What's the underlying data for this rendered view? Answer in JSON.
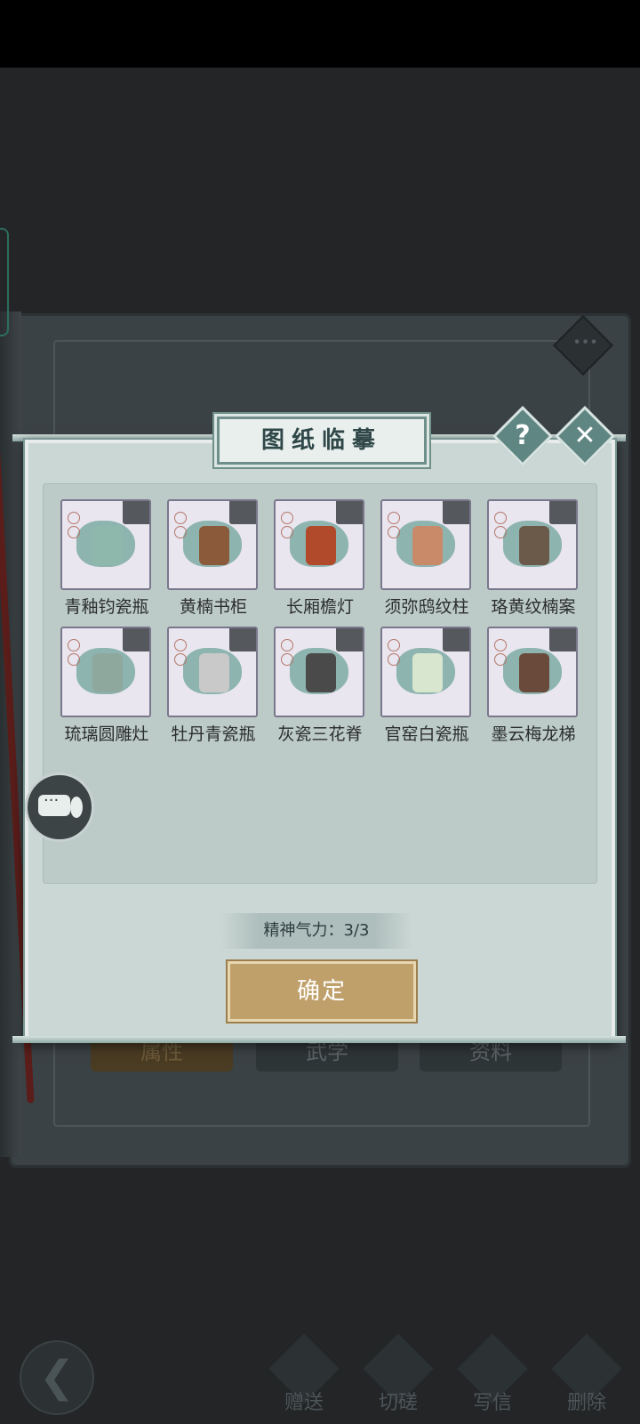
{
  "dialog": {
    "title": "图纸临摹",
    "help_glyph": "?",
    "close_glyph": "✕"
  },
  "items": [
    {
      "label": "青釉钧瓷瓶"
    },
    {
      "label": "黄楠书柜"
    },
    {
      "label": "长厢檐灯"
    },
    {
      "label": "须弥鸱纹柱"
    },
    {
      "label": "珞黄纹楠案"
    },
    {
      "label": "琉璃圆雕灶"
    },
    {
      "label": "牡丹青瓷瓶"
    },
    {
      "label": "灰瓷三花脊"
    },
    {
      "label": "官窑白瓷瓶"
    },
    {
      "label": "墨云梅龙梯"
    }
  ],
  "stamina_text": "精神气力：3/3",
  "confirm_label": "确定",
  "background_tabs": [
    "属性",
    "武学",
    "资料"
  ],
  "bottom_bar": {
    "back_glyph": "❮",
    "buttons": [
      "赠送",
      "切磋",
      "写信",
      "删除"
    ]
  },
  "colors": {
    "dialog_bg": "#cbd7d4",
    "confirm": "#bfa06a",
    "accent": "#5f8682"
  }
}
